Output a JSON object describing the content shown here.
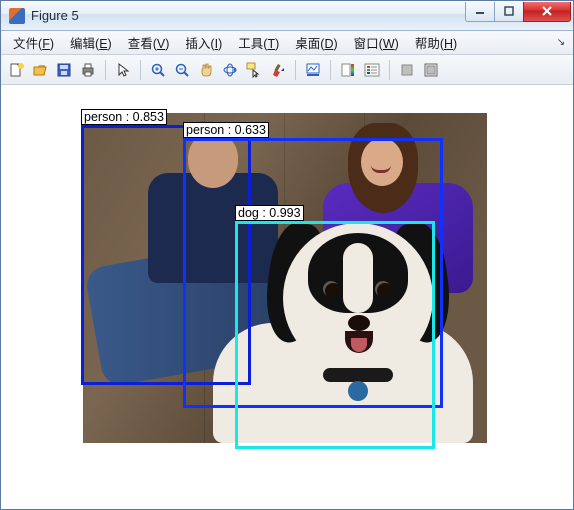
{
  "window": {
    "title": "Figure 5"
  },
  "menu": {
    "file": {
      "label": "文件",
      "accel": "F"
    },
    "edit": {
      "label": "编辑",
      "accel": "E"
    },
    "view": {
      "label": "查看",
      "accel": "V"
    },
    "insert": {
      "label": "插入",
      "accel": "I"
    },
    "tools": {
      "label": "工具",
      "accel": "T"
    },
    "desktop": {
      "label": "桌面",
      "accel": "D"
    },
    "window": {
      "label": "窗口",
      "accel": "W"
    },
    "help": {
      "label": "帮助",
      "accel": "H"
    }
  },
  "toolbar_icons": {
    "new": "new",
    "open": "open",
    "save": "save",
    "print": "print",
    "pointer": "pointer",
    "zoomin": "zoom-in",
    "zoomout": "zoom-out",
    "pan": "pan",
    "rotate": "rotate-3d",
    "datacursor": "data-cursor",
    "brush": "brush",
    "link": "link",
    "colorbar": "colorbar",
    "legend": "legend",
    "hideplot": "hide-plot-tools",
    "showplot": "show-plot-tools"
  },
  "detections": {
    "person1": {
      "label": "person : 0.853"
    },
    "person2": {
      "label": "person : 0.633"
    },
    "dog": {
      "label": "dog : 0.993"
    }
  }
}
